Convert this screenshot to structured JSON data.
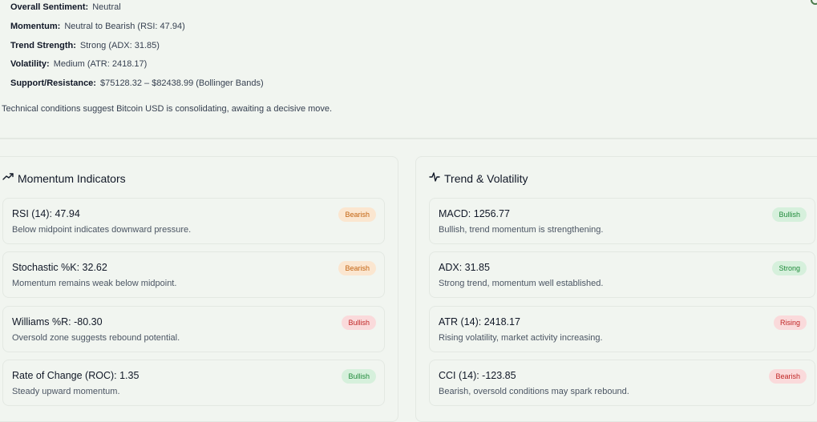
{
  "summary": [
    {
      "key": "Overall Sentiment:",
      "value": "Neutral"
    },
    {
      "key": "Momentum:",
      "value": "Neutral to Bearish (RSI: 47.94)"
    },
    {
      "key": "Trend Strength:",
      "value": "Strong (ADX: 31.85)"
    },
    {
      "key": "Volatility:",
      "value": "Medium (ATR: 2418.17)"
    },
    {
      "key": "Support/Resistance:",
      "value": "$75128.32 – $82438.99 (Bollinger Bands)"
    }
  ],
  "note": "Technical conditions suggest Bitcoin USD is consolidating, awaiting a decisive move.",
  "momentum": {
    "title": "Momentum Indicators",
    "icon": "trending-up-icon",
    "cards": [
      {
        "title": "RSI (14): 47.94",
        "desc": "Below midpoint indicates downward pressure.",
        "badge": "Bearish"
      },
      {
        "title": "Stochastic %K: 32.62",
        "desc": "Momentum remains weak below midpoint.",
        "badge": "Bearish"
      },
      {
        "title": "Williams %R: -80.30",
        "desc": "Oversold zone suggests rebound potential.",
        "badge": "Bullish"
      },
      {
        "title": "Rate of Change (ROC): 1.35",
        "desc": "Steady upward momentum.",
        "badge": "Bullish"
      }
    ]
  },
  "trend": {
    "title": "Trend & Volatility",
    "icon": "activity-icon",
    "cards": [
      {
        "title": "MACD: 1256.77",
        "desc": "Bullish, trend momentum is strengthening.",
        "badge": "Bullish"
      },
      {
        "title": "ADX: 31.85",
        "desc": "Strong trend, momentum well established.",
        "badge": "Strong"
      },
      {
        "title": "ATR (14): 2418.17",
        "desc": "Rising volatility, market activity increasing.",
        "badge": "Rising"
      },
      {
        "title": "CCI (14): -123.85",
        "desc": "Bearish, oversold conditions may spark rebound.",
        "badge": "Bearish"
      }
    ]
  },
  "colors": {
    "background": "#f1f5f0",
    "badge_orange": "#c2620f",
    "badge_red": "#c02626",
    "badge_green": "#1f8a3a"
  }
}
